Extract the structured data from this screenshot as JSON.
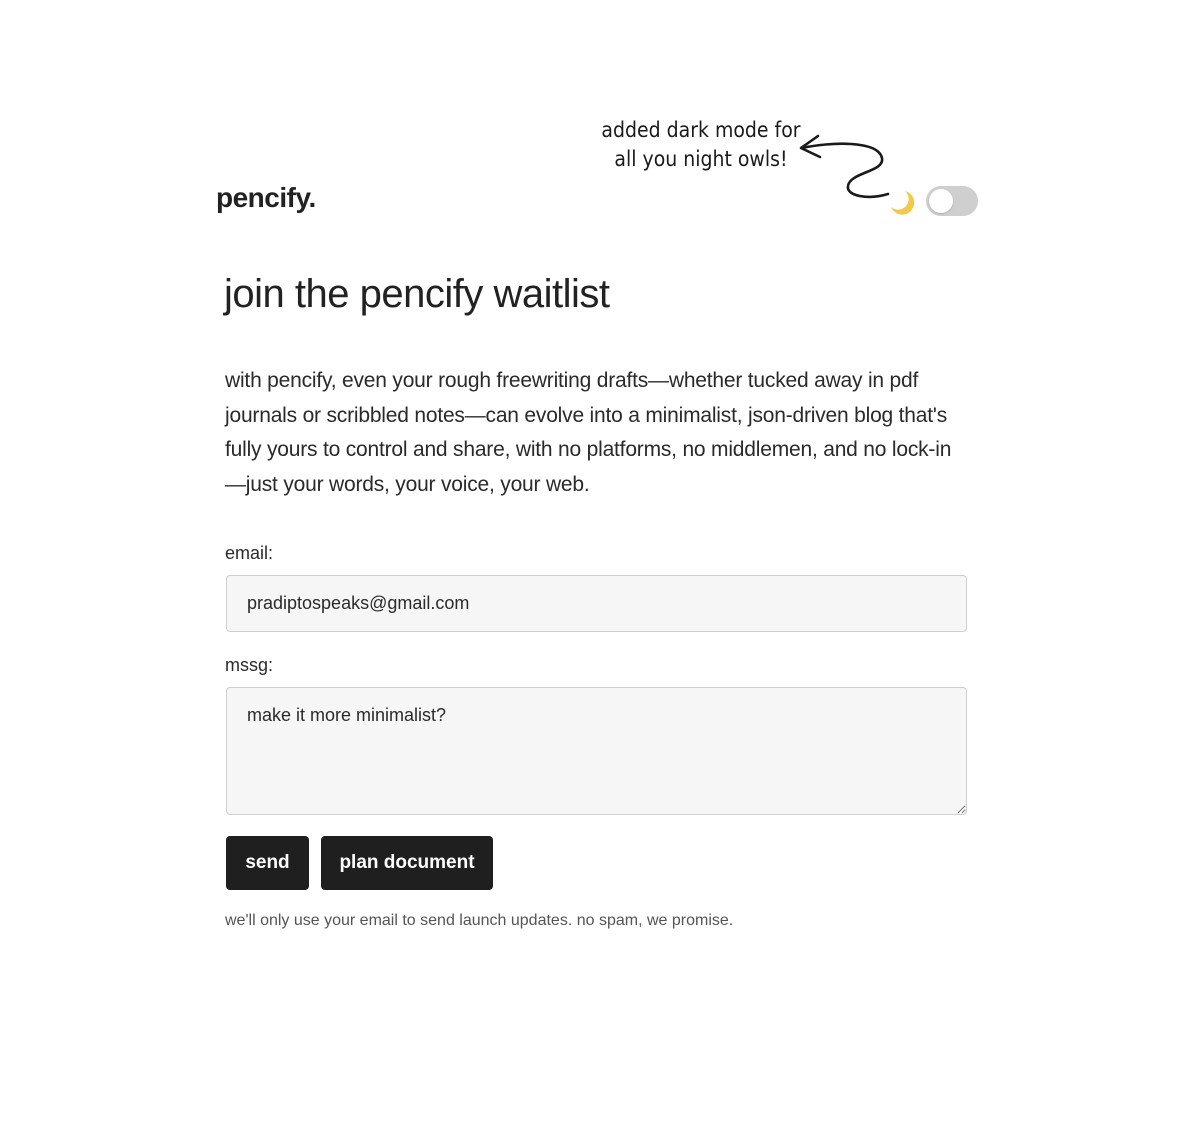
{
  "annotation": {
    "line1": "added dark mode for",
    "line2": "all you night owls!"
  },
  "header": {
    "logo": "pencify.",
    "theme_toggle": {
      "state": "off",
      "icon": "moon-icon"
    }
  },
  "main": {
    "title": "join the pencify waitlist",
    "description": "with pencify, even your rough freewriting drafts—whether tucked away in pdf journals or scribbled notes—can evolve into a minimalist, json-driven blog that's fully yours to control and share, with no platforms, no middlemen, and no lock-in—just your words, your voice, your web."
  },
  "form": {
    "email_label": "email:",
    "email_value": "pradiptospeaks@gmail.com",
    "mssg_label": "mssg:",
    "mssg_value": "make it more minimalist?",
    "send_label": "send",
    "plan_label": "plan document",
    "note": "we'll only use your email to send launch updates. no spam, we promise."
  },
  "colors": {
    "background": "#ffffff",
    "text": "#222222",
    "button": "#1f1f1f",
    "input_bg": "#f6f6f6",
    "moon": "#f2c94c",
    "toggle_track": "#cfcfcf"
  }
}
